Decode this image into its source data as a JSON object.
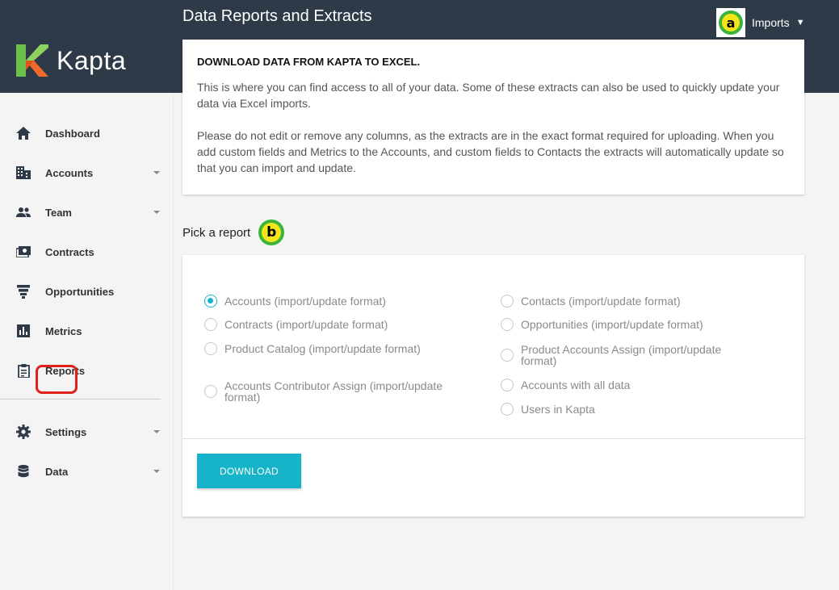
{
  "app": {
    "name": "Kapta",
    "page_title": "Data Reports and Extracts",
    "brand_colors": {
      "header": "#2e3a47",
      "accent": "#17b3c8",
      "logo_green": "#6cc04a",
      "logo_orange": "#f26a2a"
    }
  },
  "header": {
    "imports_label": "Imports",
    "badge_a": "a"
  },
  "sidebar": {
    "items": [
      {
        "label": "Dashboard",
        "icon": "home-icon",
        "has_caret": false
      },
      {
        "label": "Accounts",
        "icon": "building-icon",
        "has_caret": true
      },
      {
        "label": "Team",
        "icon": "people-icon",
        "has_caret": true
      },
      {
        "label": "Contracts",
        "icon": "money-icon",
        "has_caret": false
      },
      {
        "label": "Opportunities",
        "icon": "funnel-icon",
        "has_caret": false
      },
      {
        "label": "Metrics",
        "icon": "bar-chart-icon",
        "has_caret": false
      },
      {
        "label": "Reports",
        "icon": "clipboard-icon",
        "has_caret": false
      },
      {
        "label": "Settings",
        "icon": "gear-icon",
        "has_caret": true
      },
      {
        "label": "Data",
        "icon": "database-icon",
        "has_caret": true
      }
    ]
  },
  "info": {
    "heading": "DOWNLOAD DATA FROM KAPTA TO EXCEL.",
    "paragraph1": "This is where you can find access to all of your data. Some of these extracts can also be used to quickly update your data via Excel imports.",
    "paragraph2": "Please do not edit or remove any columns, as the extracts are in the exact format required for uploading. When you add custom fields and Metrics to the Accounts, and custom fields to Contacts the extracts will automatically update so that you can import and update."
  },
  "report": {
    "pick_label": "Pick a report",
    "badge_b": "b",
    "options": [
      {
        "label": "Accounts (import/update format)",
        "selected": true
      },
      {
        "label": "Contracts (import/update format)",
        "selected": false
      },
      {
        "label": "Product Catalog (import/update format)",
        "selected": false
      },
      {
        "label": "Accounts Contributor Assign (import/update format)",
        "selected": false
      },
      {
        "label": "Contacts (import/update format)",
        "selected": false
      },
      {
        "label": "Opportunities (import/update format)",
        "selected": false
      },
      {
        "label": "Product Accounts Assign (import/update format)",
        "selected": false
      },
      {
        "label": "Accounts with all data",
        "selected": false
      },
      {
        "label": "Users in Kapta",
        "selected": false
      }
    ],
    "download_label": "DOWNLOAD"
  }
}
